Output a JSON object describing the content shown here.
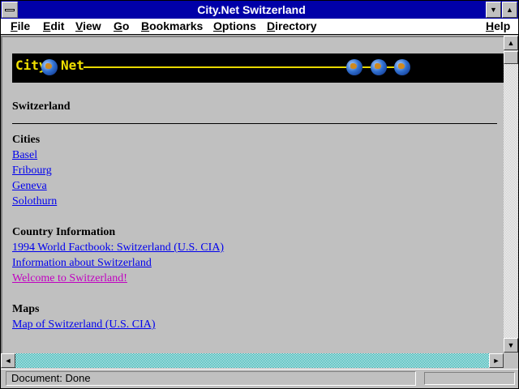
{
  "window": {
    "title": "City.Net Switzerland",
    "system_menu_icon": "system-menu-icon",
    "minimize_icon": "▼",
    "maximize_icon": "▲"
  },
  "menubar": {
    "items": [
      {
        "label": "File",
        "accel": "F",
        "rest": "ile"
      },
      {
        "label": "Edit",
        "accel": "E",
        "rest": "dit"
      },
      {
        "label": "View",
        "accel": "V",
        "rest": "iew"
      },
      {
        "label": "Go",
        "accel": "G",
        "rest": "o"
      },
      {
        "label": "Bookmarks",
        "accel": "B",
        "rest": "ookmarks"
      },
      {
        "label": "Options",
        "accel": "O",
        "rest": "ptions"
      },
      {
        "label": "Directory",
        "accel": "D",
        "rest": "irectory"
      },
      {
        "label": "Help",
        "accel": "H",
        "rest": "elp"
      }
    ]
  },
  "banner": {
    "logo_left": "City",
    "logo_right": "Net",
    "colors": {
      "background": "#000000",
      "logo": "#f0e000"
    }
  },
  "page": {
    "heading": "Switzerland",
    "sections": [
      {
        "title": "Cities",
        "links": [
          {
            "label": "Basel",
            "visited": false
          },
          {
            "label": "Fribourg",
            "visited": false
          },
          {
            "label": "Geneva",
            "visited": false
          },
          {
            "label": "Solothurn",
            "visited": false
          }
        ]
      },
      {
        "title": "Country Information",
        "links": [
          {
            "label": "1994 World Factbook: Switzerland (U.S. CIA)",
            "visited": false
          },
          {
            "label": "Information about Switzerland",
            "visited": false
          },
          {
            "label": "Welcome to Switzerland!",
            "visited": true
          }
        ]
      },
      {
        "title": "Maps",
        "links": [
          {
            "label": "Map of Switzerland (U.S. CIA)",
            "visited": false
          }
        ]
      }
    ],
    "colors": {
      "link": "#0000ee",
      "visited": "#c000c0",
      "title_bar": "#0000a8"
    }
  },
  "statusbar": {
    "text": "Document: Done"
  }
}
